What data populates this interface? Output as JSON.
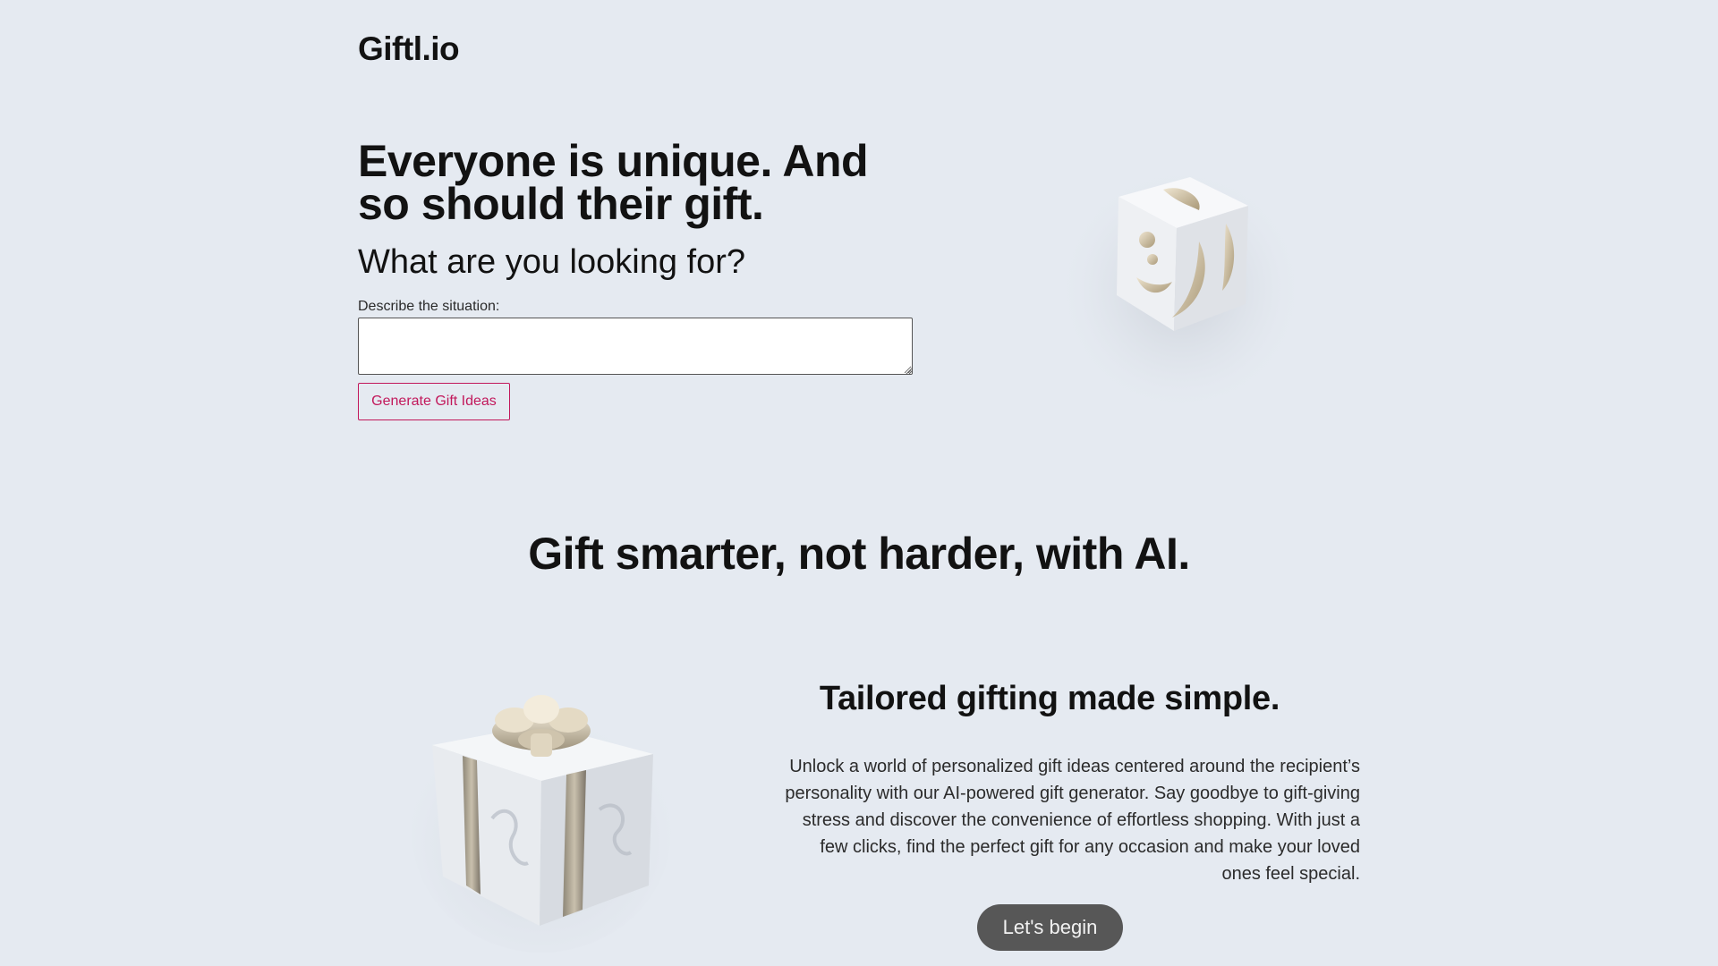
{
  "brand": {
    "logo_text": "Giftl.io"
  },
  "hero": {
    "title": "Everyone is unique. And so should their gift.",
    "subtitle": "What are you looking for?",
    "input_label": "Describe the situation:",
    "input_value": "",
    "generate_button": "Generate Gift Ideas"
  },
  "tagline": {
    "heading": "Gift smarter, not harder, with AI."
  },
  "feature": {
    "title": "Tailored gifting made simple.",
    "description": "Unlock a world of personalized gift ideas centered around the recipient’s personality with our AI-powered gift generator. Say goodbye to gift-giving stress and discover the convenience of effortless shopping. With just a few clicks, find the perfect gift for any occasion and make your loved ones feel special.",
    "cta_button": "Let's begin"
  },
  "colors": {
    "background": "#e5eaf1",
    "accent": "#c2185b",
    "cta": "#575757"
  }
}
